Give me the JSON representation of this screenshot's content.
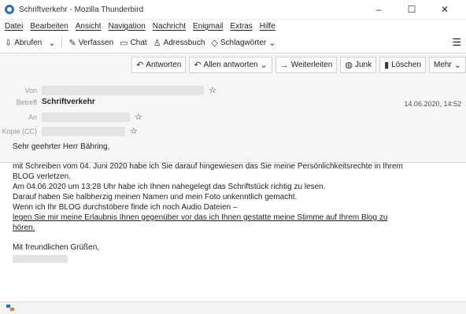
{
  "window": {
    "title": "Schriftverkehr - Mozilla Thunderbird",
    "controls": [
      "–",
      "☐",
      "✕"
    ]
  },
  "menu": [
    "Datei",
    "Bearbeiten",
    "Ansicht",
    "Navigation",
    "Nachricht",
    "Enigmail",
    "Extras",
    "Hilfe"
  ],
  "toolbar": {
    "abrufen": "Abrufen",
    "verfassen": "Verfassen",
    "chat": "Chat",
    "adressbuch": "Adressbuch",
    "schlagwoerter": "Schlagwörter"
  },
  "actions": {
    "antworten": "Antworten",
    "allen_antworten": "Allen antworten",
    "weiterleiten": "Weiterleiten",
    "junk": "Junk",
    "loeschen": "Löschen",
    "mehr": "Mehr"
  },
  "header": {
    "von_label": "Von",
    "betreff_label": "Betreff",
    "subject": "Schriftverkehr",
    "an_label": "An",
    "kopie_label": "Kopie (CC)",
    "date": "14.06.2020, 14:52"
  },
  "body": {
    "greeting": "Sehr geehrter Herr Bähring,",
    "l1": "mit Schreiben vom 04. Juni 2020 habe ich Sie darauf hingewiesen das Sie meine Persönlichkeitsrechte in Ihrem",
    "l2": "BLOG verletzen.",
    "l3": "Am 04.06.2020 um 13:28 Uhr habe ich Ihnen nahegelegt das Schriftstück richtig zu lesen.",
    "l4": "Darauf haben Sie halbherzig meinen Namen und mein Foto unkenntlich gemacht.",
    "l5": "Wenn ich Ihr BLOG durchstöbere finde ich noch Audio Dateien –",
    "l6": "legen Sie mir meine Erlaubnis Ihnen gegenüber vor das ich Ihnen gestatte meine Stimme auf Ihrem Blog zu",
    "l7": "hören.",
    "closing": "Mit freundlichen Grüßen,"
  },
  "icons": [
    "thunderbird-icon",
    "download-icon",
    "pencil-icon",
    "chat-icon",
    "address-book-icon",
    "tag-icon",
    "menu-icon",
    "reply-icon",
    "reply-all-icon",
    "forward-icon",
    "junk-icon",
    "trash-icon",
    "star-icon",
    "activity-icon"
  ]
}
